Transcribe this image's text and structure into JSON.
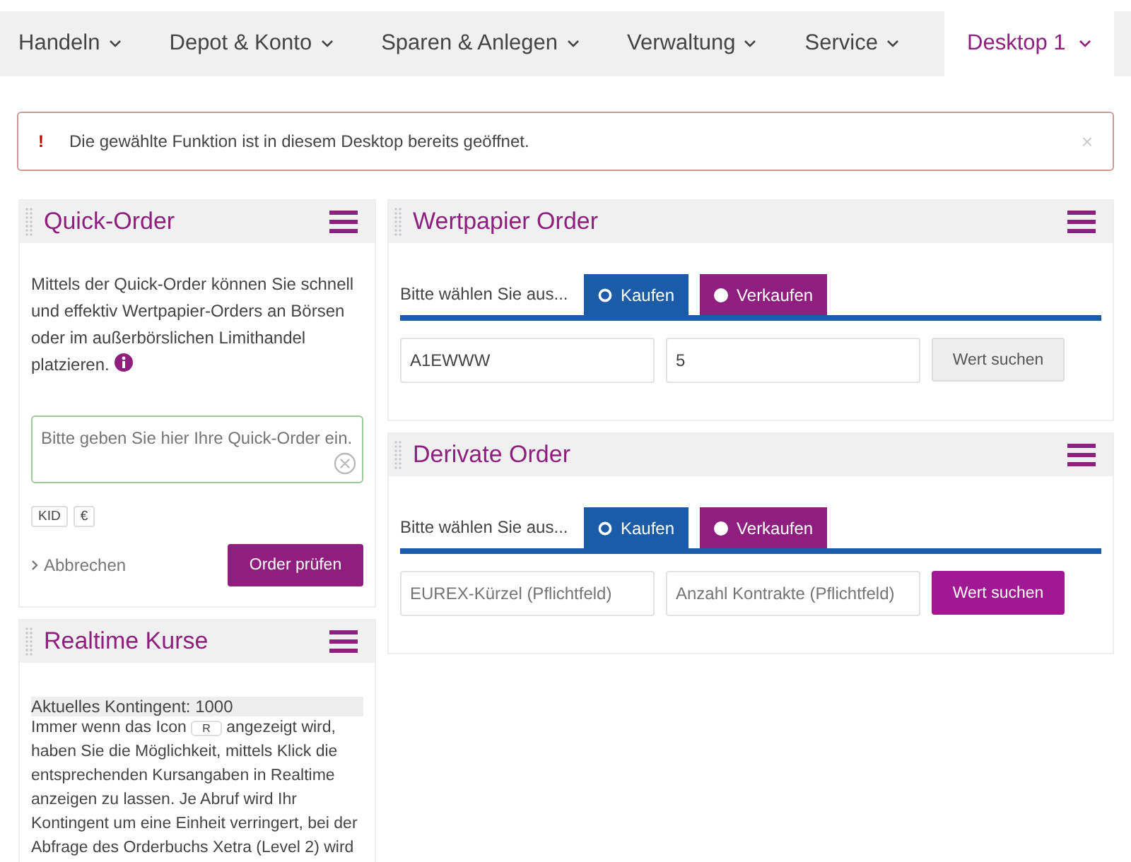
{
  "nav": [
    {
      "label": "Handeln",
      "selected": false
    },
    {
      "label": "Depot & Konto",
      "selected": false
    },
    {
      "label": "Sparen & Anlegen",
      "selected": false
    },
    {
      "label": "Verwaltung",
      "selected": false
    },
    {
      "label": "Service",
      "selected": false
    },
    {
      "label": "Desktop 1",
      "selected": true
    }
  ],
  "alert": {
    "icon": "!",
    "message": "Die gewählte Funktion ist in diesem Desktop bereits geöffnet.",
    "close": "×"
  },
  "quick_order": {
    "title": "Quick-Order",
    "description": "Mittels der Quick-Order können Sie schnell und effektiv Wertpapier-Orders an Börsen oder im außerbörslichen Limithandel platzieren.",
    "placeholder": "Bitte geben Sie hier Ihre Quick-Order ein.",
    "tags": [
      "KID",
      "€"
    ],
    "cancel": "Abbrechen",
    "submit": "Order prüfen"
  },
  "realtime": {
    "title": "Realtime Kurse",
    "quota": "Aktuelles Kontingent: 1000",
    "text_before": "Immer wenn das Icon",
    "badge": "R",
    "text_after": "angezeigt wird, haben Sie die Möglichkeit, mittels Klick die entsprechenden Kursangaben in Realtime anzeigen zu lassen. Je Abruf wird Ihr Kontingent um eine Einheit verringert, bei der Abfrage des Orderbuchs Xetra (Level 2) wird"
  },
  "orders": [
    {
      "title": "Wertpapier Order",
      "prompt": "Bitte wählen Sie aus...",
      "options": [
        {
          "label": "Kaufen",
          "selected": true
        },
        {
          "label": "Verkaufen",
          "selected": false
        }
      ],
      "fields": [
        {
          "value": "A1EWWW"
        },
        {
          "value": "5"
        }
      ],
      "search": {
        "label": "Wert suchen",
        "disabled": true
      }
    },
    {
      "title": "Derivate Order",
      "prompt": "Bitte wählen Sie aus...",
      "options": [
        {
          "label": "Kaufen",
          "selected": true
        },
        {
          "label": "Verkaufen",
          "selected": false
        }
      ],
      "fields": [
        {
          "placeholder": "EUREX-Kürzel (Pflichtfeld)"
        },
        {
          "placeholder": "Anzahl Kontrakte (Pflichtfeld)"
        }
      ],
      "search": {
        "label": "Wert suchen",
        "disabled": false
      }
    }
  ]
}
